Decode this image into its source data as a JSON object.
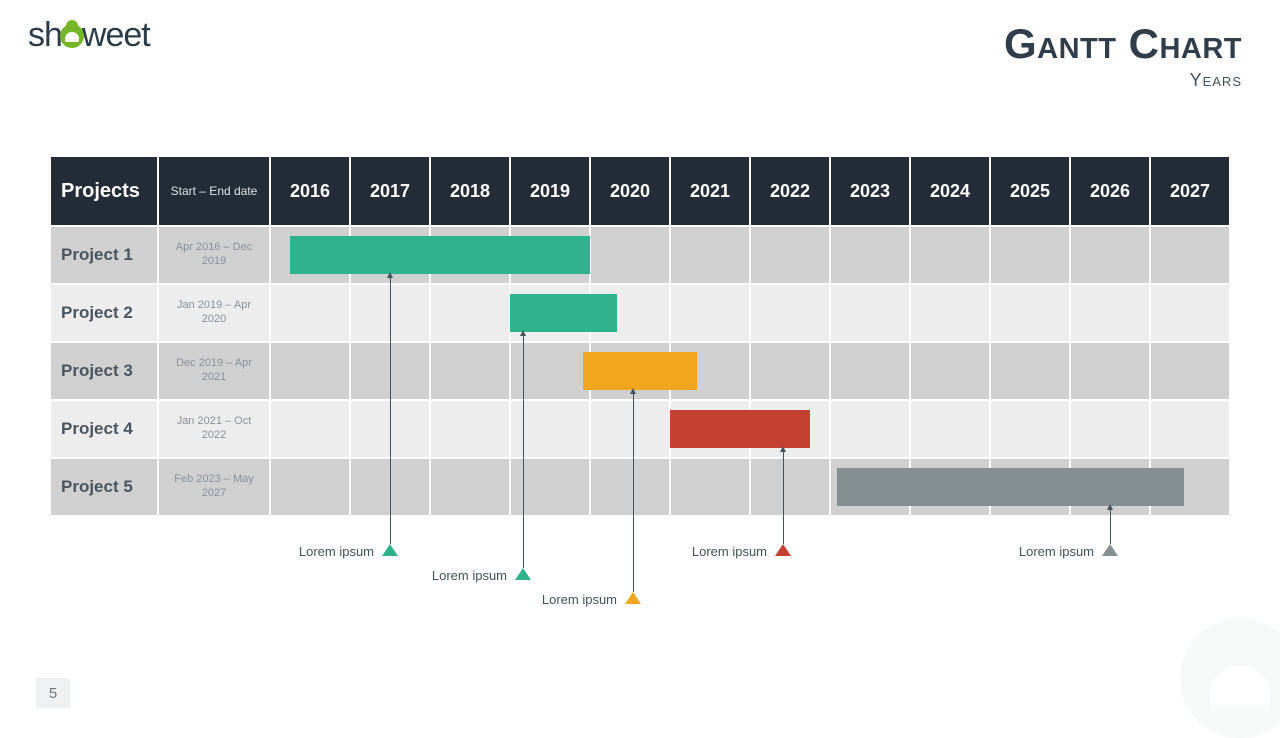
{
  "brand": {
    "pre": "sh",
    "post": "weet"
  },
  "title": "Gantt Chart",
  "subtitle": "Years",
  "page_number": "5",
  "headers": {
    "projects": "Projects",
    "dates": "Start – End date"
  },
  "years": [
    "2016",
    "2017",
    "2018",
    "2019",
    "2020",
    "2021",
    "2022",
    "2023",
    "2024",
    "2025",
    "2026",
    "2027"
  ],
  "rows": [
    {
      "name": "Project 1",
      "dates": "Apr 2016 – Dec 2019"
    },
    {
      "name": "Project 2",
      "dates": "Jan 2019 – Apr 2020"
    },
    {
      "name": "Project 3",
      "dates": "Dec 2019 – Apr 2021"
    },
    {
      "name": "Project 4",
      "dates": "Jan 2021 – Oct 2022"
    },
    {
      "name": "Project 5",
      "dates": "Feb 2023 – May 2027"
    }
  ],
  "callouts": [
    {
      "label": "Lorem ipsum",
      "color": "#2fb38b"
    },
    {
      "label": "Lorem ipsum",
      "color": "#2fb38b"
    },
    {
      "label": "Lorem ipsum",
      "color": "#f0a61e"
    },
    {
      "label": "Lorem ipsum",
      "color": "#c44131"
    },
    {
      "label": "Lorem ipsum",
      "color": "#84908f"
    }
  ],
  "chart_data": {
    "type": "gantt",
    "title": "Gantt Chart",
    "subtitle": "Years",
    "x_axis": {
      "unit": "year",
      "start": 2016,
      "end": 2027
    },
    "tasks": [
      {
        "name": "Project 1",
        "start": "2016-04",
        "end": "2019-12",
        "color": "#2fb38b",
        "start_label": "Apr 2016",
        "end_label": "Dec 2019"
      },
      {
        "name": "Project 2",
        "start": "2019-01",
        "end": "2020-04",
        "color": "#2fb38b",
        "start_label": "Jan 2019",
        "end_label": "Apr 2020"
      },
      {
        "name": "Project 3",
        "start": "2019-12",
        "end": "2021-04",
        "color": "#f0a61e",
        "start_label": "Dec 2019",
        "end_label": "Apr 2021"
      },
      {
        "name": "Project 4",
        "start": "2021-01",
        "end": "2022-10",
        "color": "#c44131",
        "start_label": "Jan 2021",
        "end_label": "Oct 2022"
      },
      {
        "name": "Project 5",
        "start": "2023-02",
        "end": "2027-05",
        "color": "#84908f",
        "start_label": "Feb 2023",
        "end_label": "May 2027"
      }
    ],
    "milestones": [
      {
        "label": "Lorem ipsum",
        "date": "2017-06",
        "task": "Project 1",
        "color": "#2fb38b"
      },
      {
        "label": "Lorem ipsum",
        "date": "2019-02",
        "task": "Project 2",
        "color": "#2fb38b"
      },
      {
        "label": "Lorem ipsum",
        "date": "2020-07",
        "task": "Project 3",
        "color": "#f0a61e"
      },
      {
        "label": "Lorem ipsum",
        "date": "2022-06",
        "task": "Project 4",
        "color": "#c44131"
      },
      {
        "label": "Lorem ipsum",
        "date": "2026-06",
        "task": "Project 5",
        "color": "#84908f"
      }
    ]
  }
}
